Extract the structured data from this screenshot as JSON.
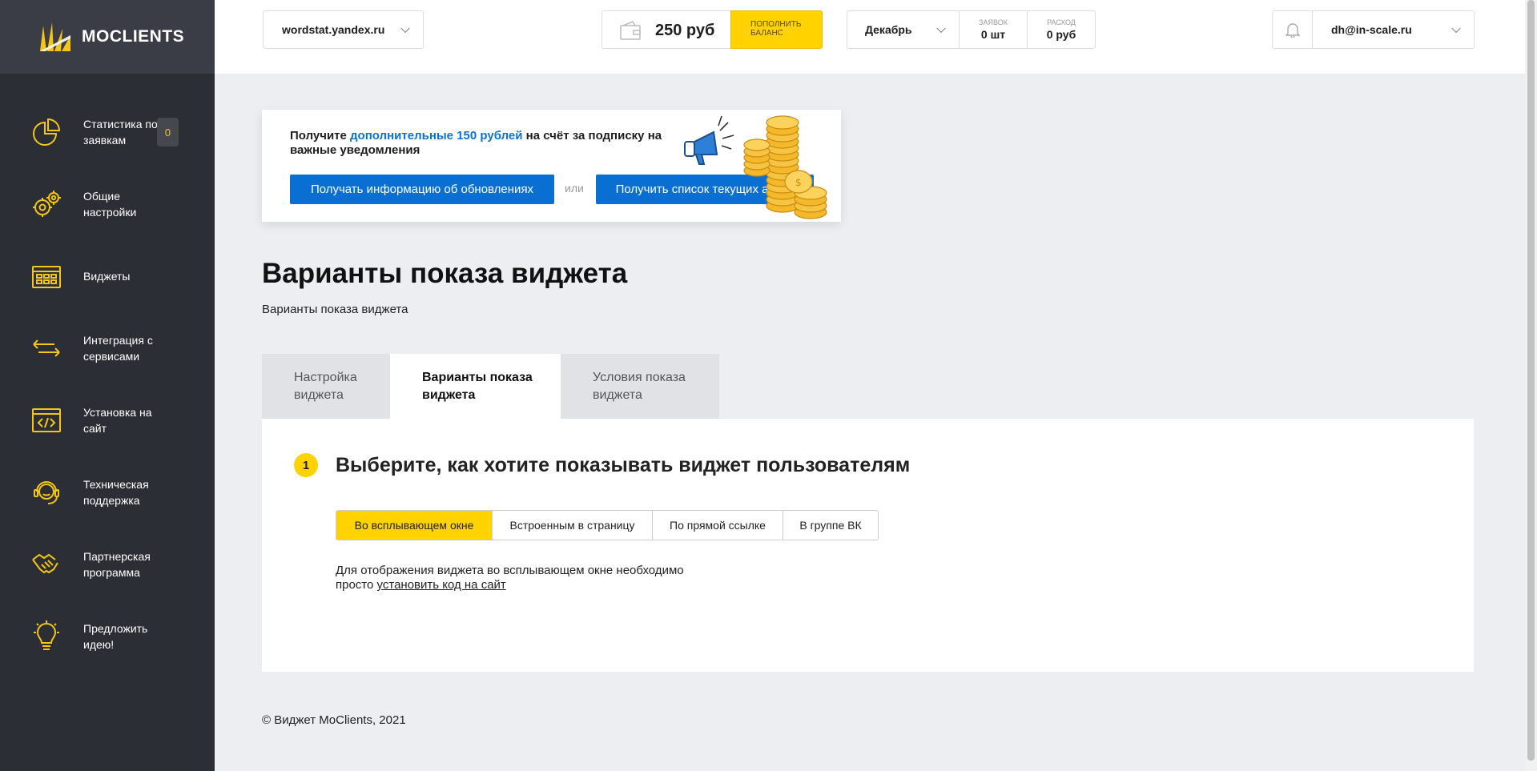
{
  "brand": {
    "name": "MOCLIENTS",
    "accent": "#ffd200",
    "sidebar_bg": "#2c2e35"
  },
  "sidebar": {
    "items": [
      {
        "label": "Статистика по заявкам",
        "icon": "pie-chart-icon",
        "badge": "0"
      },
      {
        "label": "Общие настройки",
        "icon": "gears-icon"
      },
      {
        "label": "Виджеты",
        "icon": "widgets-grid-icon"
      },
      {
        "label": "Интеграция с сервисами",
        "icon": "arrows-exchange-icon"
      },
      {
        "label": "Установка на сайт",
        "icon": "code-window-icon"
      },
      {
        "label": "Техническая поддержка",
        "icon": "headset-icon"
      },
      {
        "label": "Партнерская программа",
        "icon": "handshake-icon"
      },
      {
        "label": "Предложить идею!",
        "icon": "lightbulb-icon"
      }
    ]
  },
  "topbar": {
    "site": "wordstat.yandex.ru",
    "balance": "250 руб",
    "topup_label": "ПОПОЛНИТЬ БАЛАНС",
    "month": "Декабрь",
    "leads_caption": "ЗАЯВОК",
    "leads_value": "0 шт",
    "spend_caption": "РАСХОД",
    "spend_value": "0 руб",
    "user_email": "dh@in-scale.ru"
  },
  "promo": {
    "text_before": "Получите ",
    "text_highlight": "дополнительные 150 рублей",
    "text_after": " на счёт за подписку на важные уведомления",
    "button_updates": "Получать информацию об обновлениях",
    "or_label": "или",
    "button_promos": "Получить список текущих акций"
  },
  "page": {
    "title": "Варианты показа виджета",
    "subtitle": "Варианты показа виджета"
  },
  "tabs": [
    {
      "label": "Настройка виджета",
      "active": false
    },
    {
      "label": "Варианты показа виджета",
      "active": true
    },
    {
      "label": "Условия показа виджета",
      "active": false
    }
  ],
  "step": {
    "number": "1",
    "title": "Выберите, как хотите показывать виджет пользователям",
    "options": [
      {
        "label": "Во всплывающем окне",
        "active": true
      },
      {
        "label": "Встроенным в страницу",
        "active": false
      },
      {
        "label": "По прямой ссылке",
        "active": false
      },
      {
        "label": "В группе ВК",
        "active": false
      }
    ],
    "desc_before": "Для отображения виджета во всплывающем окне необходимо просто ",
    "desc_link": "установить код на сайт"
  },
  "footer": {
    "copyright": "© Виджет MoClients, 2021"
  }
}
